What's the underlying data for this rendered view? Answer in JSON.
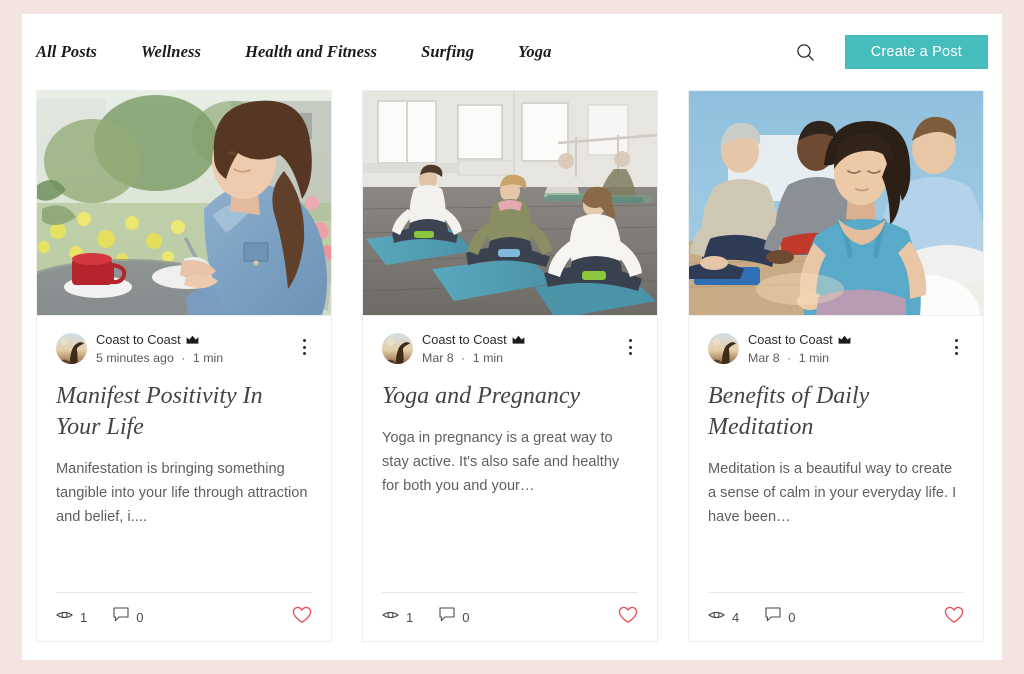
{
  "theme": {
    "page_background": "#f3e3e1",
    "content_background": "#ffffff",
    "accent": "#45bdbd",
    "like_color": "#e8505b",
    "text_primary": "#1b1b1b",
    "text_secondary": "#5f5f5f"
  },
  "header": {
    "nav": [
      {
        "label": "All Posts"
      },
      {
        "label": "Wellness"
      },
      {
        "label": "Health and Fitness"
      },
      {
        "label": "Surfing"
      },
      {
        "label": "Yoga"
      }
    ],
    "search_icon": "search-icon",
    "create_label": "Create a Post"
  },
  "cards": [
    {
      "image": "woman-writing-at-outdoor-cafe",
      "author": "Coast to Coast",
      "badge_icon": "crown-icon",
      "date": "5 minutes ago",
      "separator": "·",
      "read_time": "1 min",
      "title": "Manifest Positivity In Your Life",
      "excerpt": "Manifestation is bringing something tangible into your life through attraction and belief, i....",
      "views_icon": "eye-icon",
      "views": "1",
      "comments_icon": "comment-icon",
      "comments": "0",
      "like_icon": "heart-icon",
      "more_icon": "more-vertical-icon"
    },
    {
      "image": "prenatal-yoga-class-studio",
      "author": "Coast to Coast",
      "badge_icon": "crown-icon",
      "date": "Mar 8",
      "separator": "·",
      "read_time": "1 min",
      "title": "Yoga and Pregnancy",
      "excerpt": "Yoga in pregnancy is a great way to stay active. It's also safe and healthy for both you and your…",
      "views_icon": "eye-icon",
      "views": "1",
      "comments_icon": "comment-icon",
      "comments": "0",
      "like_icon": "heart-icon",
      "more_icon": "more-vertical-icon"
    },
    {
      "image": "group-meditation-class",
      "author": "Coast to Coast",
      "badge_icon": "crown-icon",
      "date": "Mar 8",
      "separator": "·",
      "read_time": "1 min",
      "title": "Benefits of Daily Meditation",
      "excerpt": "Meditation is a beautiful way to create a sense of calm in your everyday life. I have been…",
      "views_icon": "eye-icon",
      "views": "4",
      "comments_icon": "comment-icon",
      "comments": "0",
      "like_icon": "heart-icon",
      "more_icon": "more-vertical-icon"
    }
  ]
}
